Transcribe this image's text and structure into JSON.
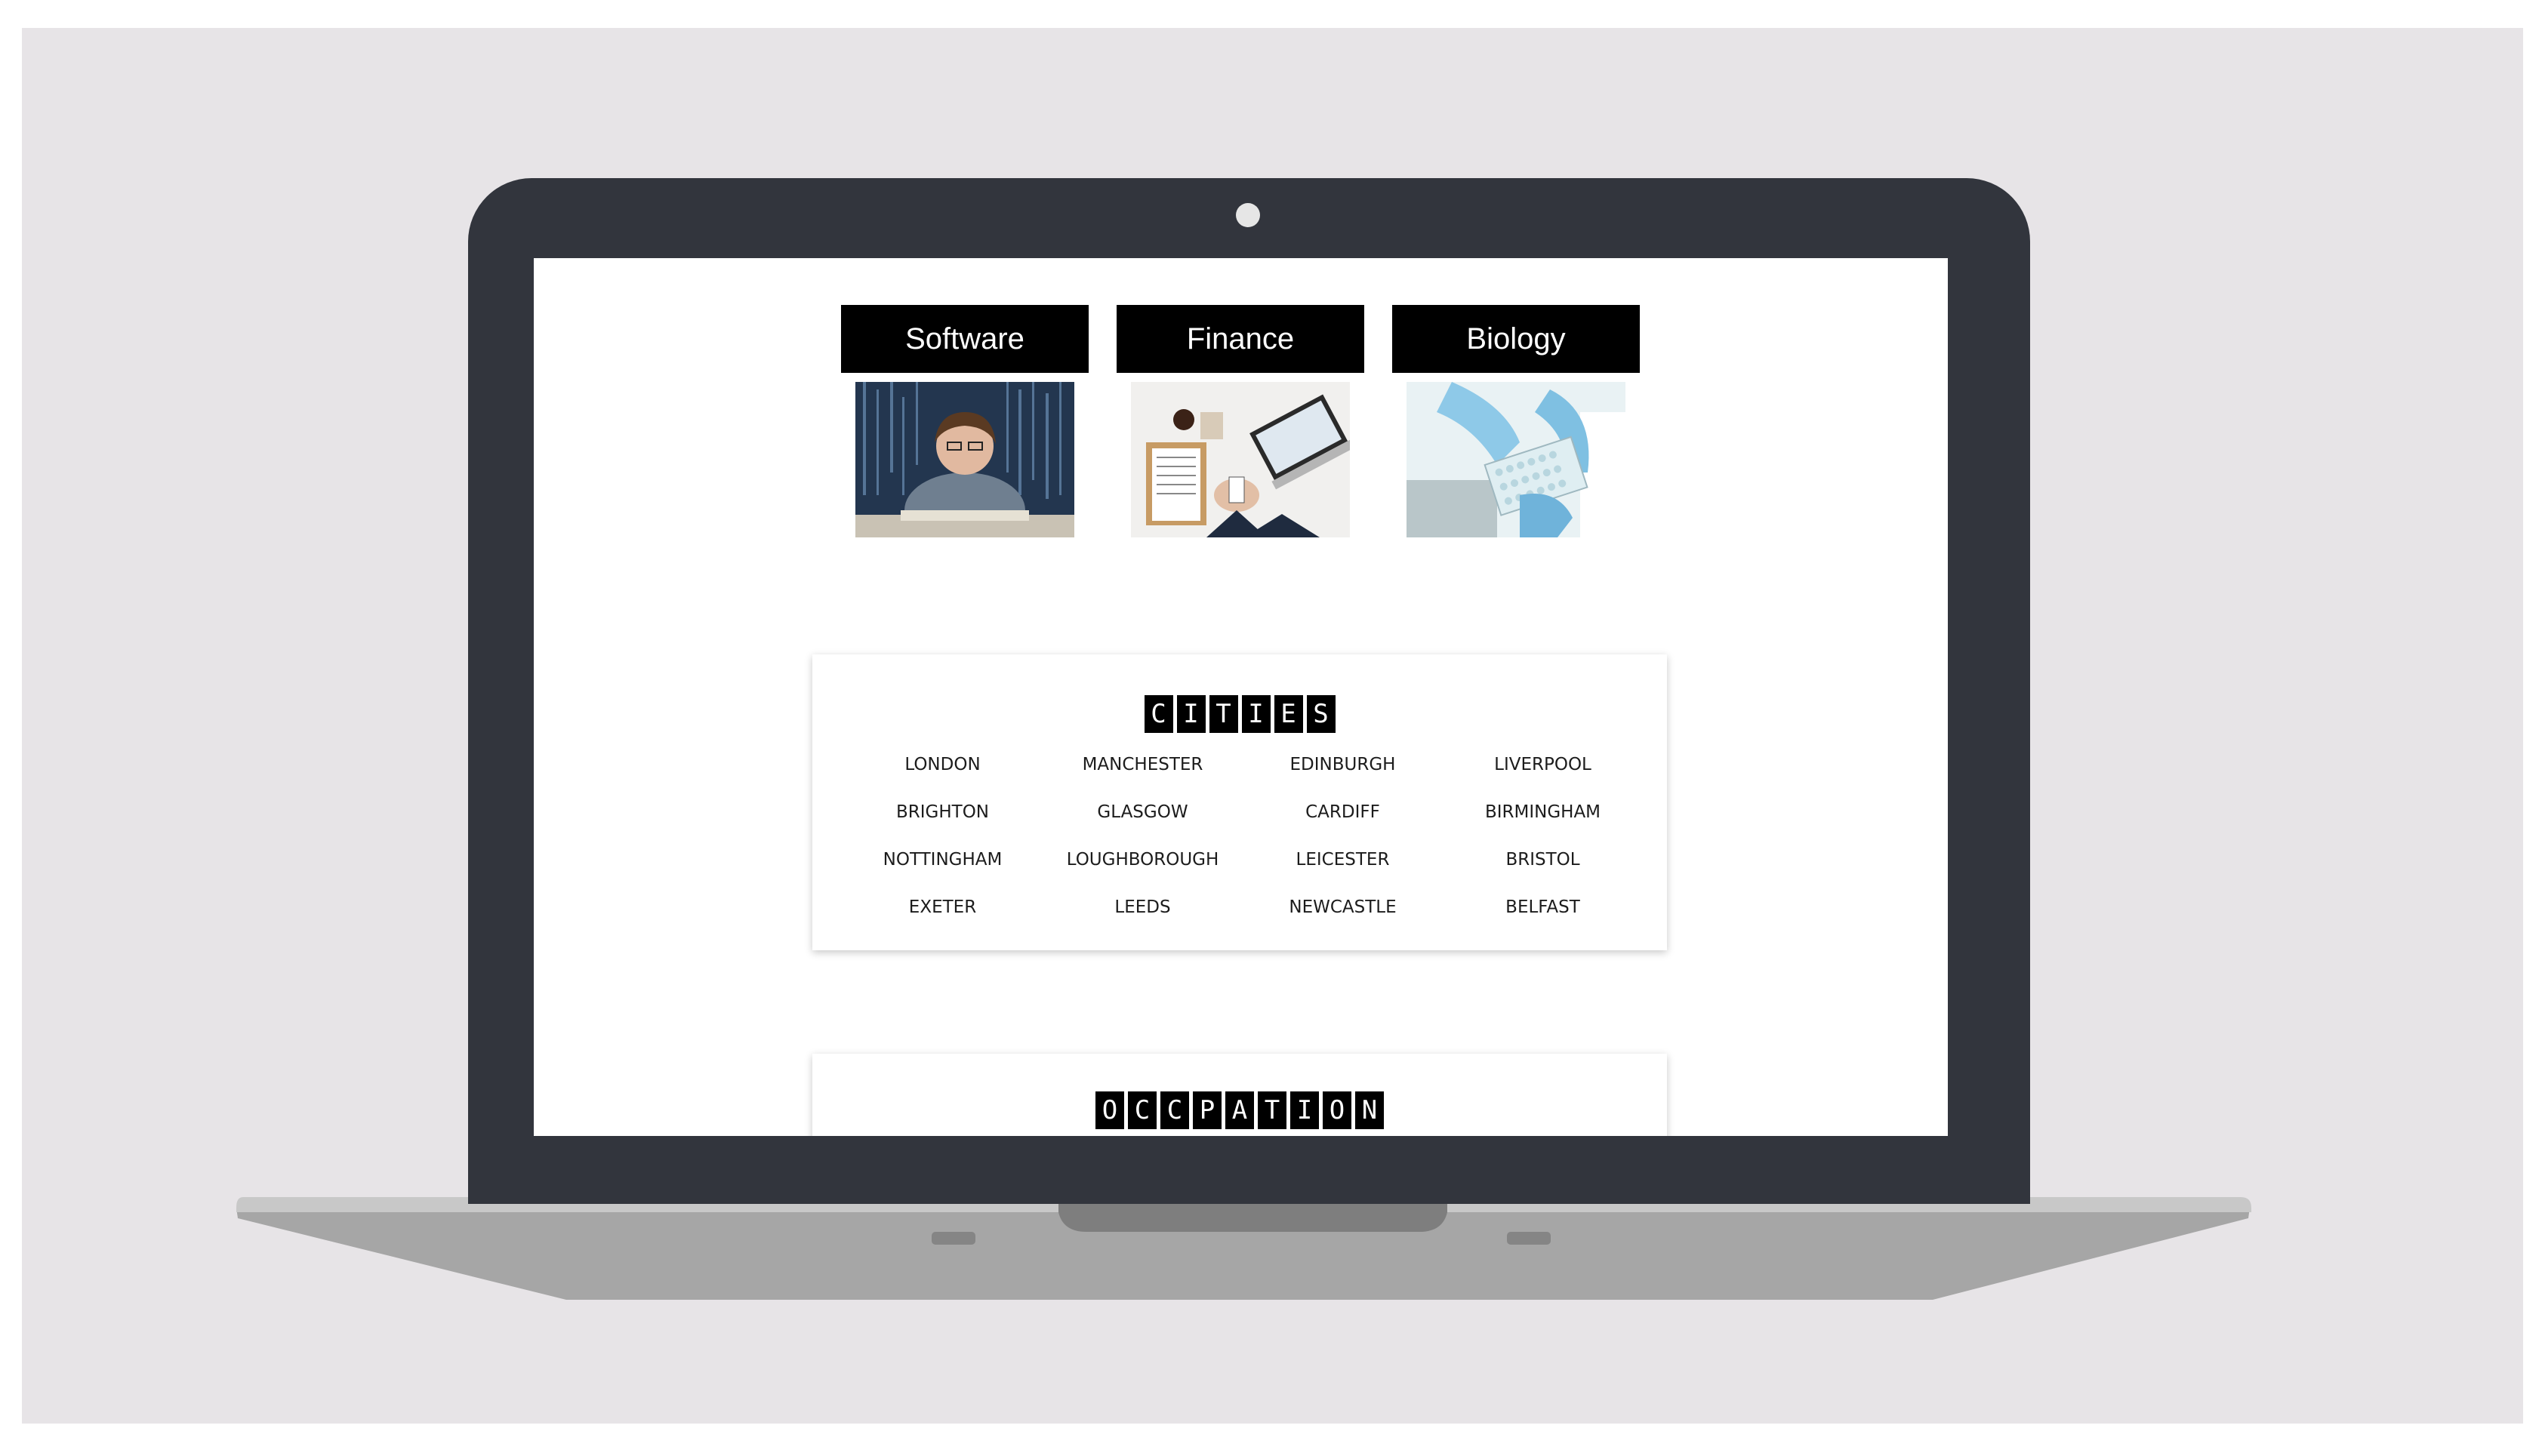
{
  "categories": [
    {
      "label": "Software",
      "image": "boy-coding-photo"
    },
    {
      "label": "Finance",
      "image": "desk-documents-laptop-photo"
    },
    {
      "label": "Biology",
      "image": "gloved-hands-lab-photo"
    }
  ],
  "cities_section": {
    "heading_letters": [
      "C",
      "I",
      "T",
      "I",
      "E",
      "S"
    ],
    "items": [
      "LONDON",
      "MANCHESTER",
      "EDINBURGH",
      "LIVERPOOL",
      "BRIGHTON",
      "GLASGOW",
      "CARDIFF",
      "BIRMINGHAM",
      "NOTTINGHAM",
      "LOUGHBOROUGH",
      "LEICESTER",
      "BRISTOL",
      "EXETER",
      "LEEDS",
      "NEWCASTLE",
      "BELFAST"
    ]
  },
  "occupation_section": {
    "heading_letters": [
      "O",
      "C",
      "C",
      "P",
      "A",
      "T",
      "I",
      "O",
      "N"
    ]
  },
  "colors": {
    "background": "#e7e4e7",
    "laptop_bezel": "#32353d",
    "laptop_base": "#a6a6a6",
    "heading_bg": "#000000",
    "heading_text": "#ffffff"
  }
}
